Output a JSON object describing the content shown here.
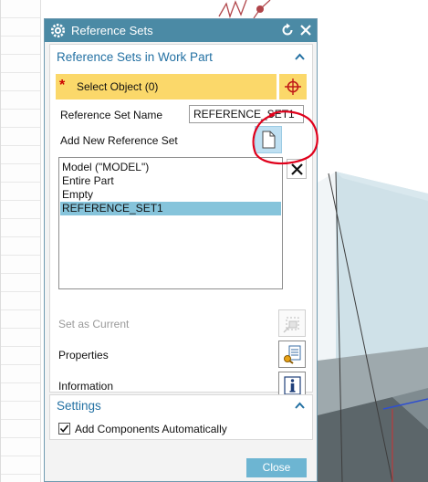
{
  "dialog": {
    "title": "Reference Sets",
    "reset_icon": "reset-icon",
    "close_icon": "close-icon",
    "title_icon": "gear-icon"
  },
  "section_refsets": {
    "title": "Reference Sets in Work Part",
    "collapse_icon": "chevron-up-icon",
    "select_object": {
      "required_icon": "asterisk-icon",
      "label": "Select Object (0)",
      "picker_icon": "crosshair-icon"
    },
    "ref_name_label": "Reference Set Name",
    "ref_name_value": "REFERENCE_SET1",
    "add_new_label": "Add New Reference Set",
    "add_new_icon": "new-document-icon",
    "delete_icon": "delete-x-icon",
    "list_items": [
      {
        "label": "Model (\"MODEL\")",
        "selected": false
      },
      {
        "label": "Entire Part",
        "selected": false
      },
      {
        "label": "Empty",
        "selected": false
      },
      {
        "label": "REFERENCE_SET1",
        "selected": true
      }
    ],
    "set_as_current_label": "Set as Current",
    "set_as_current_enabled": false,
    "properties_label": "Properties",
    "information_label": "Information"
  },
  "section_settings": {
    "title": "Settings",
    "collapse_icon": "chevron-up-icon",
    "add_components_label": "Add Components Automatically",
    "add_components_checked": true
  },
  "footer": {
    "close_label": "Close"
  },
  "colors": {
    "title_bar": "#4b8aa5",
    "section_title": "#2471a3",
    "select_highlight": "#fbd86a",
    "list_selected": "#86c4db",
    "close_button": "#6db5d2",
    "annotation_circle": "#e0001b"
  }
}
